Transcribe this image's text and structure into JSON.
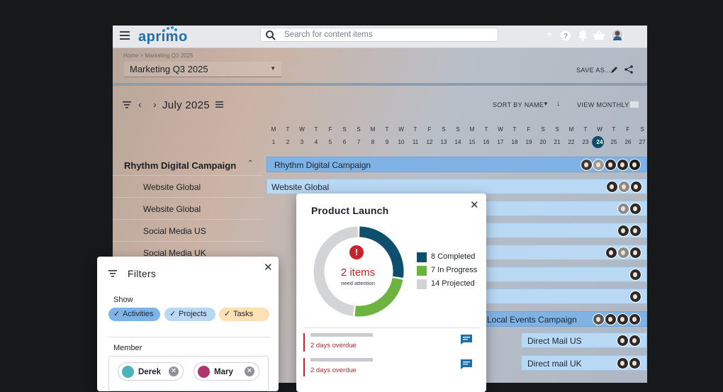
{
  "header": {
    "logo": "aprimo",
    "search_placeholder": "Search for content items",
    "icons": [
      "menu-icon",
      "plus-icon",
      "help-icon",
      "bell-icon",
      "basket-icon",
      "user-avatar"
    ]
  },
  "breadcrumb": "Home > Marketing Q3 2025",
  "project_selector": {
    "value": "Marketing Q3 2025"
  },
  "actions": {
    "save_as": "SAVE AS...",
    "sort": "SORT BY NAME",
    "view": "VIEW MONTHLY"
  },
  "calendar": {
    "month": "July 2025",
    "weekdays": [
      "M",
      "T",
      "W",
      "T",
      "F",
      "S",
      "S",
      "M",
      "T",
      "W",
      "T",
      "F",
      "S",
      "S",
      "M",
      "T",
      "W",
      "T",
      "F",
      "S",
      "S",
      "M",
      "T",
      "W",
      "T",
      "F",
      "S"
    ],
    "days": [
      "1",
      "2",
      "3",
      "4",
      "5",
      "6",
      "7",
      "8",
      "9",
      "10",
      "11",
      "12",
      "13",
      "14",
      "15",
      "16",
      "17",
      "18",
      "19",
      "20",
      "21",
      "22",
      "23",
      "24",
      "25",
      "26",
      "27"
    ],
    "today": "24"
  },
  "rows": {
    "campaign": "Rhythm Digital Campaign",
    "items": [
      "Website Global",
      "Website Global",
      "Social Media US",
      "Social Media UK"
    ]
  },
  "bars": {
    "rhythm": "Rhythm Digital Campaign",
    "website": "Website Global",
    "local_events": "Local Events Campaign",
    "direct_mail_us": "Direct Mail US",
    "direct_mail_uk": "Direct mail UK"
  },
  "popup": {
    "title": "Product Launch",
    "attention_count": "2 items",
    "attention_label": "need attention",
    "legend": [
      {
        "label": "8 Completed",
        "value": 8,
        "color": "#0f4f6e"
      },
      {
        "label": "7 In Progress",
        "value": 7,
        "color": "#6cb33f"
      },
      {
        "label": "14 Projected",
        "value": 14,
        "color": "#d3d4d6"
      }
    ],
    "overdue": [
      "2 days overdue",
      "2 days overdue"
    ]
  },
  "filters": {
    "title": "Filters",
    "show_label": "Show",
    "chips": [
      {
        "label": "Activities",
        "color": "#7fb3e6"
      },
      {
        "label": "Projects",
        "color": "#b9d8f4"
      },
      {
        "label": "Tasks",
        "color": "#fde0b3"
      }
    ],
    "member_label": "Member",
    "members": [
      "Derek",
      "Mary"
    ]
  }
}
